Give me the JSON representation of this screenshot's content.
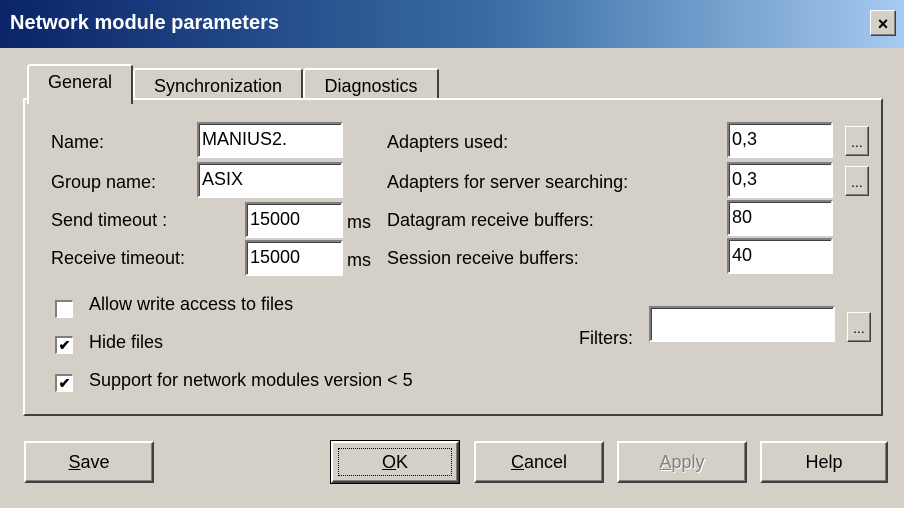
{
  "window": {
    "title": "Network module parameters",
    "close_glyph": "×"
  },
  "tabs": [
    {
      "label": "General",
      "active": true
    },
    {
      "label": "Synchronization",
      "active": false
    },
    {
      "label": "Diagnostics",
      "active": false
    }
  ],
  "general": {
    "name_label": "Name:",
    "name_value": "MANIUS2.",
    "group_label": "Group name:",
    "group_value": "ASIX",
    "send_timeout_label": "Send timeout :",
    "send_timeout_value": "15000",
    "receive_timeout_label": "Receive timeout:",
    "receive_timeout_value": "15000",
    "ms_unit": "ms",
    "adapters_used_label": "Adapters used:",
    "adapters_used_value": "0,3",
    "adapters_search_label": "Adapters for server searching:",
    "adapters_search_value": "0,3",
    "datagram_label": "Datagram receive buffers:",
    "datagram_value": "80",
    "session_label": "Session receive buffers:",
    "session_value": "40",
    "filters_label": "Filters:",
    "filters_value": "",
    "browse_label": "...",
    "checkboxes": [
      {
        "label": "Allow write access to files",
        "checked": false
      },
      {
        "label": "Hide files",
        "checked": true
      },
      {
        "label": "Support for network modules version < 5",
        "checked": true
      }
    ],
    "check_glyph": "✔"
  },
  "buttons": {
    "save": {
      "mnemonic": "S",
      "rest": "ave"
    },
    "ok": {
      "mnemonic": "O",
      "rest": "K"
    },
    "cancel": {
      "mnemonic": "C",
      "rest": "ancel"
    },
    "apply": {
      "mnemonic": "A",
      "rest": "pply",
      "disabled": true
    },
    "help": {
      "label": "Help"
    }
  }
}
